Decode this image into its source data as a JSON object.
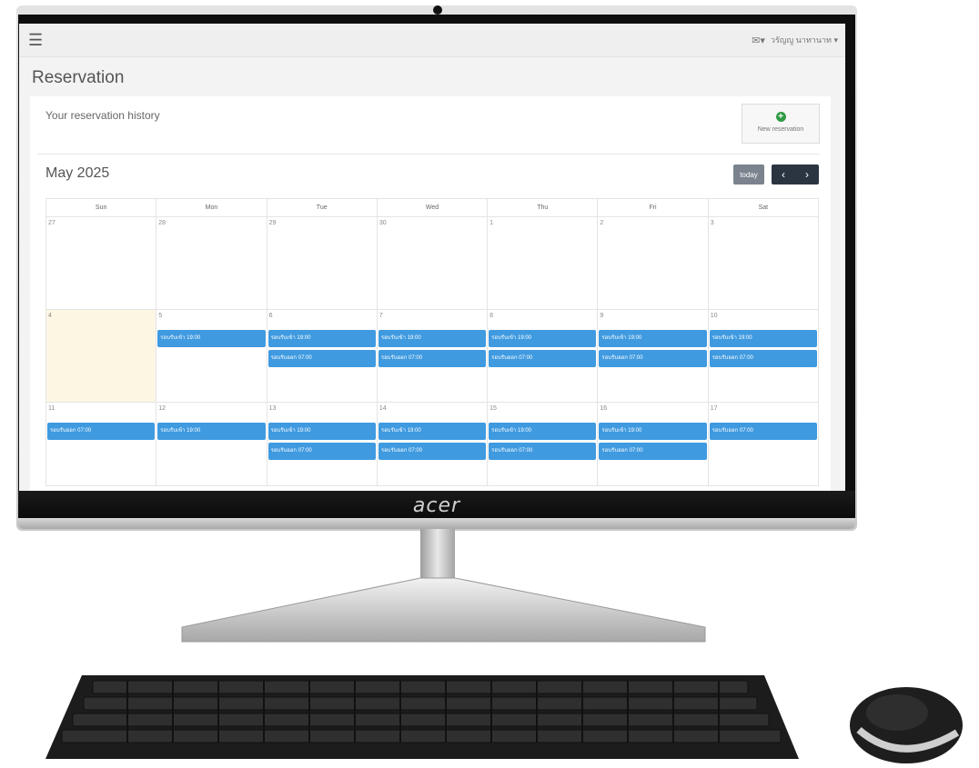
{
  "header": {
    "user_name": "วรัญญู นาทานาท"
  },
  "page": {
    "title": "Reservation",
    "history_label": "Your reservation history",
    "new_reservation_label": "New reservation"
  },
  "calendar": {
    "month_title": "May 2025",
    "today_label": "today",
    "prev_symbol": "‹",
    "next_symbol": "›",
    "weekdays": [
      "Sun",
      "Mon",
      "Tue",
      "Wed",
      "Thu",
      "Fri",
      "Sat"
    ],
    "weeks": [
      [
        {
          "day": "27",
          "events": []
        },
        {
          "day": "28",
          "events": []
        },
        {
          "day": "29",
          "events": []
        },
        {
          "day": "30",
          "events": []
        },
        {
          "day": "1",
          "events": []
        },
        {
          "day": "2",
          "events": []
        },
        {
          "day": "3",
          "events": []
        }
      ],
      [
        {
          "day": "4",
          "today": true,
          "events": []
        },
        {
          "day": "5",
          "events": [
            "รอบรับเข้า 19:00"
          ]
        },
        {
          "day": "6",
          "events": [
            "รอบรับเข้า 19:00",
            "รอบรับออก 07:00"
          ]
        },
        {
          "day": "7",
          "events": [
            "รอบรับเข้า 19:00",
            "รอบรับออก 07:00"
          ]
        },
        {
          "day": "8",
          "events": [
            "รอบรับเข้า 19:00",
            "รอบรับออก 07:00"
          ]
        },
        {
          "day": "9",
          "events": [
            "รอบรับเข้า 19:00",
            "รอบรับออก 07:00"
          ]
        },
        {
          "day": "10",
          "events": [
            "รอบรับเข้า 19:00",
            "รอบรับออก 07:00"
          ]
        }
      ],
      [
        {
          "day": "11",
          "events": [
            "รอบรับออก 07:00"
          ]
        },
        {
          "day": "12",
          "events": [
            "รอบรับเข้า 19:00"
          ]
        },
        {
          "day": "13",
          "events": [
            "รอบรับเข้า 19:00",
            "รอบรับออก 07:00"
          ]
        },
        {
          "day": "14",
          "events": [
            "รอบรับเข้า 19:00",
            "รอบรับออก 07:00"
          ]
        },
        {
          "day": "15",
          "events": [
            "รอบรับเข้า 19:00",
            "รอบรับออก 07:00"
          ]
        },
        {
          "day": "16",
          "events": [
            "รอบรับเข้า 19:00",
            "รอบรับออก 07:00"
          ]
        },
        {
          "day": "17",
          "events": [
            "รอบรับออก 07:00"
          ]
        }
      ]
    ]
  },
  "device": {
    "brand": "acer"
  },
  "colors": {
    "event": "#3f9ae0",
    "today_cell": "#fcf6e3",
    "nav_button": "#2b3542",
    "today_button": "#7b838e",
    "add_icon": "#2f9a44"
  },
  "icons": [
    "hamburger-menu-icon",
    "mail-icon",
    "plus-circle-icon",
    "chevron-left-icon",
    "chevron-right-icon"
  ]
}
